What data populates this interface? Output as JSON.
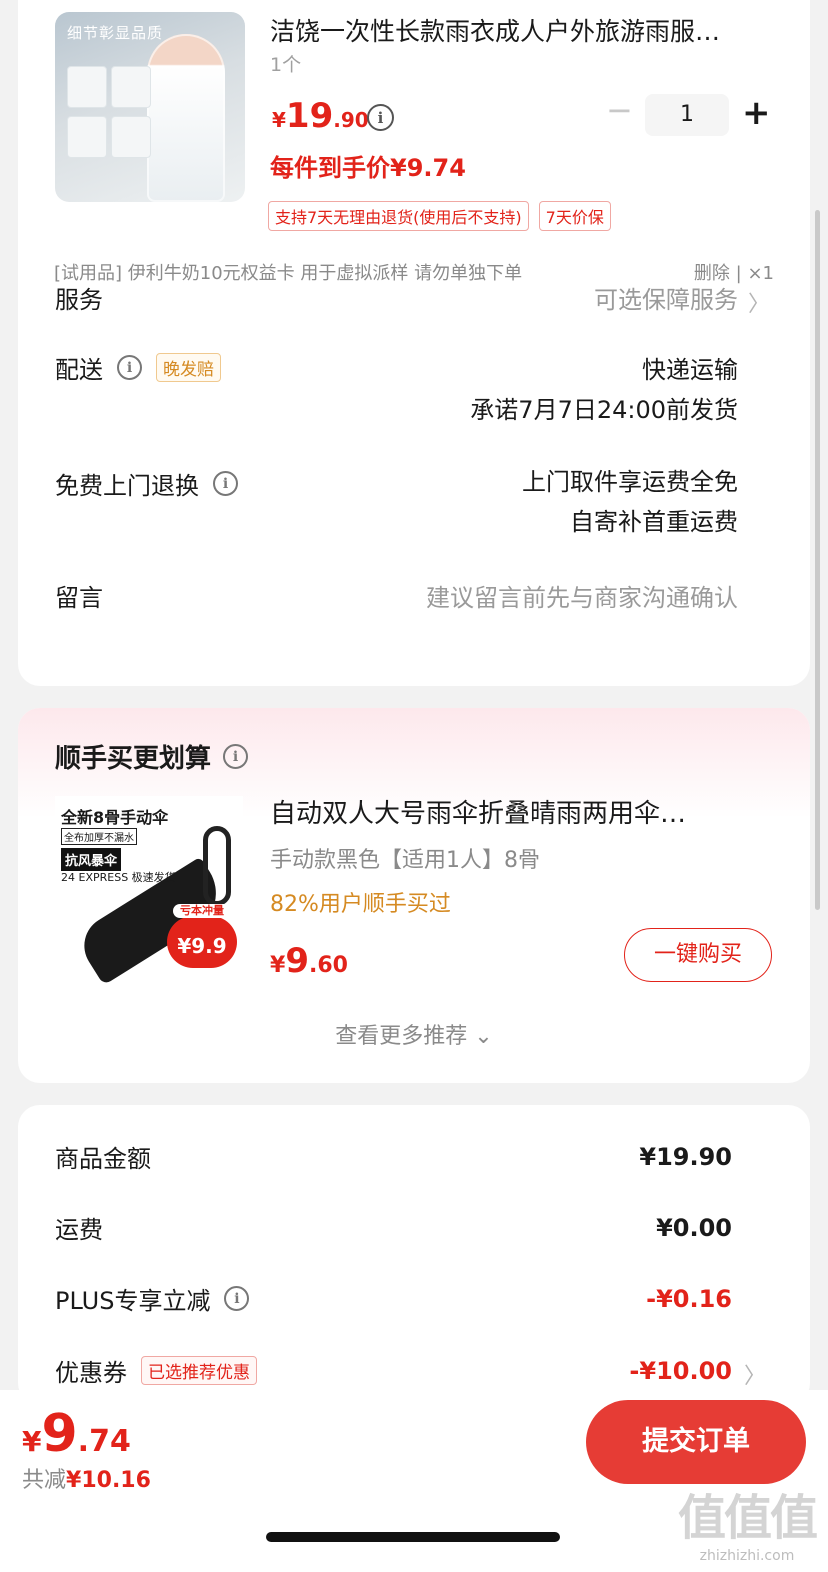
{
  "product": {
    "title": "洁饶一次性长款雨衣成人户外旅游雨服…",
    "image_tag": "细节彰显品质",
    "qty_note": "1个",
    "price_yen": "¥",
    "price_int": "19",
    "price_dec": ".90",
    "quantity": "1",
    "minus": "−",
    "plus": "+",
    "unit_price": "每件到手价¥9.74",
    "badges": [
      "支持7天无理由退货(使用后不支持)",
      "7天价保"
    ]
  },
  "gift": {
    "text": "[试用品] 伊利牛奶10元权益卡 用于虚拟派样 请勿单独下单",
    "delete": "删除",
    "sep": "|",
    "count": "×1"
  },
  "rows": {
    "service_label": "服务",
    "service_value": "可选保障服务",
    "delivery_label": "配送",
    "delivery_tag": "晚发赔",
    "delivery_value1": "快递运输",
    "delivery_value2": "承诺7月7日24:00前发货",
    "return_label": "免费上门退换",
    "return_value1": "上门取件享运费全免",
    "return_value2": "自寄补首重运费",
    "message_label": "留言",
    "message_placeholder": "建议留言前先与商家沟通确认"
  },
  "recommend": {
    "title": "顺手买更划算",
    "img_t1": "全新8骨手动伞",
    "img_t2": "全布加厚不漏水",
    "img_t3": "抗风暴伞",
    "img_t4": "24 EXPRESS 极速发货",
    "img_badge_top": "亏本冲量",
    "img_badge_price": "¥9.9",
    "product_title": "自动双人大号雨伞折叠晴雨两用伞…",
    "spec": "手动款黑色【适用1人】8骨",
    "bought": "82%用户顺手买过",
    "price_yen": "¥",
    "price_int": "9",
    "price_dec": ".60",
    "buy_button": "一键购买",
    "more": "查看更多推荐 ⌄"
  },
  "summary": {
    "goods_label": "商品金额",
    "goods_value": "¥19.90",
    "shipping_label": "运费",
    "shipping_value": "¥0.00",
    "plus_label": "PLUS专享立减",
    "plus_value": "-¥0.16",
    "coupon_label": "优惠券",
    "coupon_tag": "已选推荐优惠",
    "coupon_value": "-¥10.00"
  },
  "bottom": {
    "total_yen": "¥",
    "total_int": "9",
    "total_dec": ".74",
    "saved_label": "共减",
    "saved_value": "¥10.16",
    "submit": "提交订单",
    "watermark_big": "值值值",
    "watermark_small": "zhizhizhi.com"
  },
  "colors": {
    "accent": "#e2231a",
    "submit_bg": "#e63c35",
    "orange": "#d58a22"
  }
}
